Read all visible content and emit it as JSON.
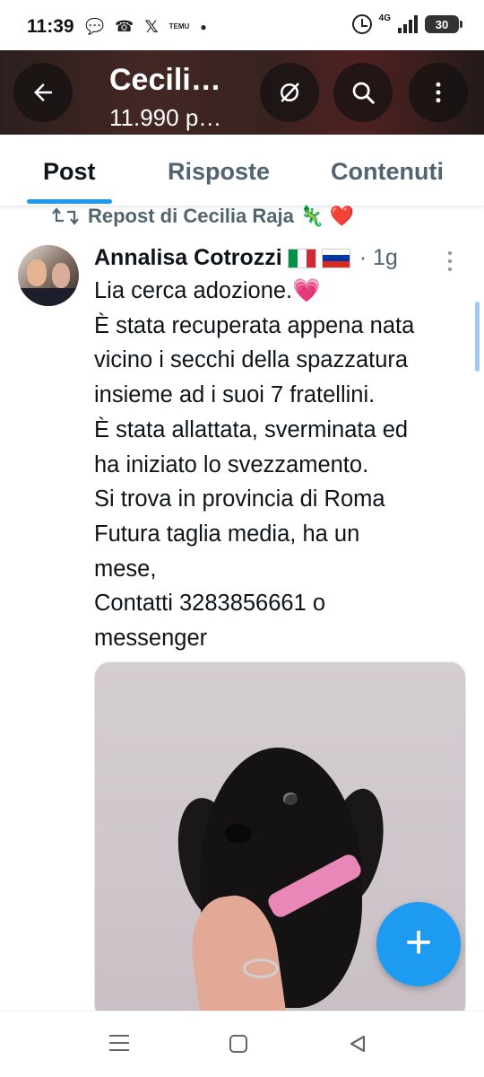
{
  "status_bar": {
    "time": "11:39",
    "notification_icons": [
      "chat-icon",
      "missed-call-icon",
      "x-logo-icon",
      "temu-icon",
      "dot-icon"
    ],
    "temu_label": "TEMU",
    "network": "4G",
    "battery": "30"
  },
  "header": {
    "title": "Cecili…",
    "subtitle": "11.990 p…",
    "buttons": [
      "back-arrow-icon",
      "unfollow-icon",
      "search-icon",
      "more-icon"
    ]
  },
  "tabs": [
    {
      "label": "Post",
      "active": true
    },
    {
      "label": "Risposte",
      "active": false
    },
    {
      "label": "Contenuti",
      "active": false
    }
  ],
  "colors": {
    "accent": "#1d9bf0",
    "text_primary": "#0f1419",
    "text_secondary": "#536471"
  },
  "repost": {
    "text": "Repost di Cecilia Raja 🦎 ❤️"
  },
  "tweet": {
    "author": "Annalisa Cotrozzi",
    "flags": [
      "italy-flag-icon",
      "russia-flag-icon"
    ],
    "time": "· 1g",
    "lines": [
      "Lia cerca adozione.💗",
      "È stata recuperata appena nata",
      "vicino i secchi della spazzatura",
      "insieme ad i suoi 7 fratellini.",
      "È stata allattata, sverminata ed",
      "ha iniziato  lo svezzamento.",
      "Si trova in provincia di Roma",
      "Futura taglia media,  ha un",
      "mese,",
      "Contatti 3283856661 o",
      "messenger"
    ],
    "media": "puppy-photo"
  },
  "fab": {
    "icon": "plus-icon",
    "label": "+"
  }
}
